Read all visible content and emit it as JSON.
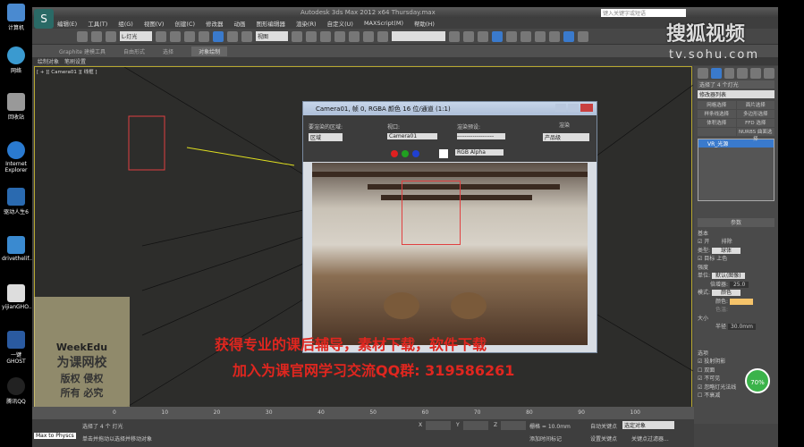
{
  "desktop": {
    "icons": [
      "计算机",
      "网络",
      "回收站",
      "Internet Explorer",
      "驱动人生6",
      "drivethelif...",
      "yijianGHO...",
      "一键GHOST",
      "腾讯QQ"
    ]
  },
  "window": {
    "title": "Autodesk 3ds Max  2012 x64     Thursday.max",
    "search_placeholder": "键入关键字或短语"
  },
  "menu": [
    "编辑(E)",
    "工具(T)",
    "组(G)",
    "视图(V)",
    "创建(C)",
    "修改器",
    "动画",
    "图形编辑器",
    "渲染(R)",
    "自定义(U)",
    "MAXScript(M)",
    "帮助(H)"
  ],
  "toolbar": {
    "selection_filter": "L-灯光",
    "ref_coord": "视图"
  },
  "ribbon": {
    "tabs": [
      "Graphite 建模工具",
      "自由形式",
      "选择",
      "对象绘制"
    ],
    "active": 3,
    "sub": [
      "绘制对象",
      "笔刷设置"
    ]
  },
  "viewport": {
    "label": "[ + ][ Camera01 ][ 线框 ]"
  },
  "command_panel": {
    "name_field": "选择了 4 个灯光",
    "modifier_list": "修改器列表",
    "buttons": [
      "网格选择",
      "面片选择",
      "样条线选择",
      "多边形选择",
      "体积选择",
      "FFD 选择",
      "",
      "NURBS 曲面选择"
    ],
    "stack_item": "VR_光源",
    "params": {
      "title": "参数",
      "section_basic": "基本",
      "on": "开",
      "exclude": "排除",
      "type_label": "类型:",
      "type": "球体",
      "targeted": "目标 上色",
      "section_intensity": "强度",
      "unit_label": "单位:",
      "unit": "默认(图像)",
      "multiplier_label": "倍增器:",
      "multiplier": "25.0",
      "mode_label": "模式:",
      "mode": "颜色",
      "color_label": "颜色:",
      "temp_label": "色温:",
      "section_size": "大小",
      "radius_label": "半径",
      "radius": "30.0mm",
      "section_options": "选项",
      "options": [
        "投射阴影",
        "双面",
        "不可见",
        "忽略灯光法线",
        "不衰减"
      ],
      "color": "#f5c36a"
    }
  },
  "render_dialog": {
    "title": "Camera01, 帧 0, RGBA 颜色 16 位/通道 (1:1)",
    "area_label": "要渲染的区域:",
    "area": "区域",
    "viewport_label": "视口:",
    "viewport": "Camera01",
    "preset_label": "渲染预设:",
    "preset": "-------------------",
    "render_label": "渲染",
    "render_mode": "产品级",
    "channel": "RGB Alpha"
  },
  "overlay": {
    "line1": "获得专业的课后辅导，素材下载，软件下载",
    "line2": "加入为课官网学习交流QQ群: 319586261"
  },
  "weekedu": {
    "brand": "WeekEdu",
    "name": "为课网校",
    "line1": "版权 侵权",
    "line2": "所有 必究"
  },
  "watermark": {
    "brand": "搜狐视频",
    "url": "tv.sohu.com"
  },
  "status": {
    "ticks": [
      "0",
      "10",
      "20",
      "30",
      "40",
      "50",
      "60",
      "70",
      "80",
      "90",
      "100"
    ],
    "selected": "选择了 4 个 灯光",
    "prompt": "单击并拖动以选择并移动对象",
    "script": "Max to Physcs",
    "grid": "栅格 = 10.0mm",
    "autokey": "自动关键点",
    "setkey": "设置关键点",
    "key_filter": "选定对象",
    "add_time_tag": "添加时间标记",
    "key_filters": "关键点过滤器...",
    "x_label": "X",
    "y_label": "Y",
    "z_label": "Z"
  },
  "badge": {
    "value": "70%"
  }
}
